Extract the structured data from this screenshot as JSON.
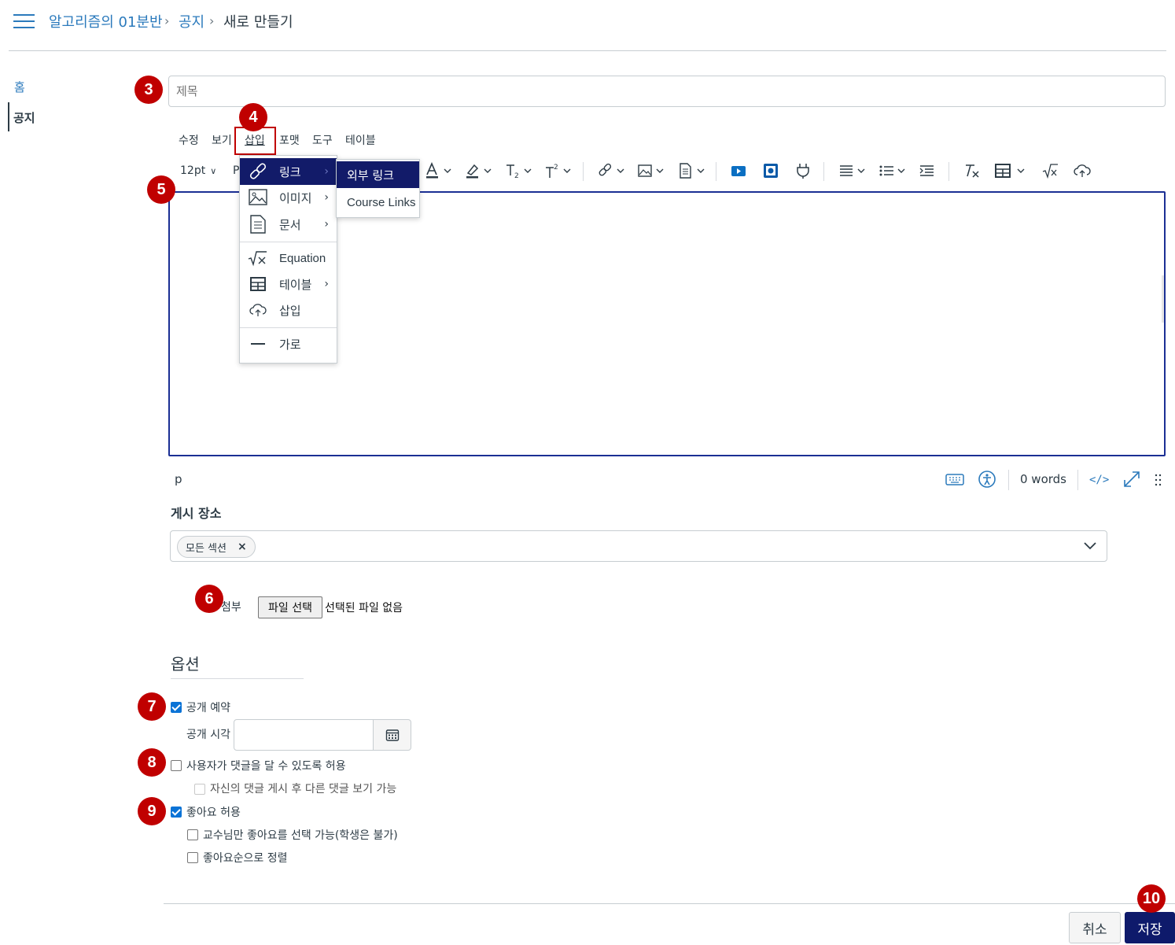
{
  "breadcrumb": {
    "course": "알고리즘의 01분반",
    "section": "공지",
    "current": "새로 만들기"
  },
  "sidebar": {
    "items": [
      {
        "label": "홈",
        "active": false
      },
      {
        "label": "공지",
        "active": true
      }
    ]
  },
  "title_field": {
    "placeholder": "제목",
    "value": ""
  },
  "editor": {
    "menubar": [
      "수정",
      "보기",
      "삽입",
      "포맷",
      "도구",
      "테이블"
    ],
    "font_size": "12pt",
    "paragraph_partial": "P",
    "status_path": "p",
    "word_count": "0 words",
    "icons": [
      "text-color-icon",
      "highlight-icon",
      "subscript-icon",
      "superscript-icon",
      "link-icon",
      "image-icon",
      "document-icon",
      "media-icon",
      "record-icon",
      "plugin-icon",
      "align-icon",
      "list-icon",
      "indent-icon",
      "clear-format-icon",
      "table-icon",
      "equation-icon",
      "cloud-upload-icon"
    ]
  },
  "insert_menu": {
    "items": [
      {
        "label": "링크",
        "icon": "link-icon",
        "submenu": true,
        "highlighted": true
      },
      {
        "label": "이미지",
        "icon": "image-icon",
        "submenu": true
      },
      {
        "label": "문서",
        "icon": "document-icon",
        "submenu": true
      },
      {
        "label": "Equation",
        "icon": "equation-icon",
        "submenu": false
      },
      {
        "label": "테이블",
        "icon": "table-icon",
        "submenu": true
      },
      {
        "label": "삽입",
        "icon": "cloud-upload-icon",
        "submenu": false
      },
      {
        "label": "가로",
        "icon": "horizontal-rule-icon",
        "submenu": false
      }
    ],
    "link_submenu": [
      "외부 링크",
      "Course Links"
    ]
  },
  "post_to": {
    "label": "게시 장소",
    "selected_tag": "모든 섹션"
  },
  "attachment": {
    "label": "첨부",
    "button": "파일 선택",
    "status": "선택된 파일 없음"
  },
  "options": {
    "heading": "옵션",
    "delay_posting": {
      "label": "공개 예약",
      "checked": true
    },
    "available_from": {
      "label": "공개 시각",
      "value": ""
    },
    "allow_comments": {
      "label": "사용자가 댓글을 달 수 있도록 허용",
      "checked": false
    },
    "must_post_first": {
      "label": "자신의 댓글 게시 후 다른 댓글 보기 가능",
      "checked": false,
      "disabled": true
    },
    "allow_liking": {
      "label": "좋아요 허용",
      "checked": true
    },
    "only_graders_like": {
      "label": "교수님만 좋아요를 선택 가능(학생은 불가)",
      "checked": false
    },
    "sort_by_likes": {
      "label": "좋아요순으로 정렬",
      "checked": false
    }
  },
  "actions": {
    "cancel": "취소",
    "save": "저장"
  },
  "annotations": [
    "3",
    "4",
    "5",
    "6",
    "7",
    "8",
    "9",
    "10"
  ],
  "colors": {
    "accent": "#2b7abc",
    "annotation": "#c00000",
    "primary_button": "#0e1a6b",
    "menu_highlight": "#121b69"
  }
}
